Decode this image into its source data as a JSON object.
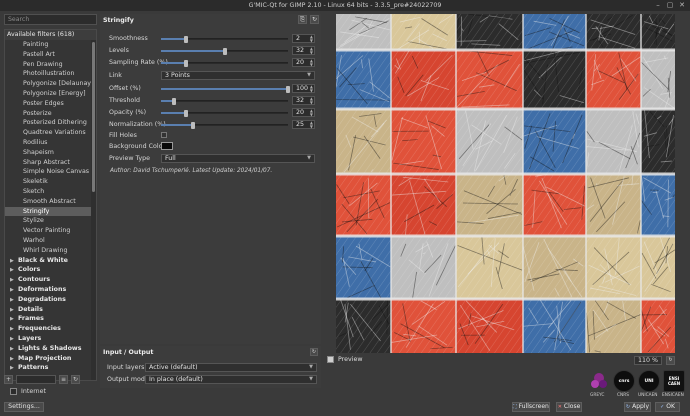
{
  "window": {
    "title": "G'MIC-Qt for GIMP 2.10 - Linux 64 bits - 3.3.5_pre#24022709",
    "controls": [
      "minimize-icon",
      "maximize-icon",
      "close-icon"
    ]
  },
  "search": {
    "placeholder": "Search"
  },
  "filter_list": {
    "header": "Available filters (618)",
    "items": [
      "Painting",
      "Pastell Art",
      "Pen Drawing",
      "Photoillustration",
      "Polygonize [Delaunay]",
      "Polygonize [Energy]",
      "Poster Edges",
      "Posterize",
      "Posterized Dithering",
      "Quadtree Variations",
      "Rodilius",
      "Shapeism",
      "Sharp Abstract",
      "Simple Noise Canvas",
      "Skeletik",
      "Sketch",
      "Smooth Abstract",
      "Stringify",
      "Stylize",
      "Vector Painting",
      "Warhol",
      "Whirl Drawing"
    ],
    "selected": "Stringify",
    "categories": [
      "Black & White",
      "Colors",
      "Contours",
      "Deformations",
      "Degradations",
      "Details",
      "Frames",
      "Frequencies",
      "Layers",
      "Lights & Shadows",
      "Map Projection",
      "Patterns"
    ]
  },
  "left_footer": {
    "internet_label": "Internet",
    "settings_label": "Settings..."
  },
  "filter": {
    "name": "Stringify",
    "params": {
      "smoothness": {
        "label": "Smoothness",
        "value": "2",
        "fraction": 0.2
      },
      "levels": {
        "label": "Levels",
        "value": "32",
        "fraction": 0.5
      },
      "sampling_rate": {
        "label": "Sampling Rate (%)",
        "value": "20",
        "fraction": 0.2
      },
      "link": {
        "label": "Link",
        "value": "3 Points"
      },
      "offset": {
        "label": "Offset (%)",
        "value": "100",
        "fraction": 1.0
      },
      "threshold": {
        "label": "Threshold",
        "value": "32",
        "fraction": 0.1
      },
      "opacity": {
        "label": "Opacity (%)",
        "value": "20",
        "fraction": 0.2
      },
      "normalization": {
        "label": "Normalization (%)",
        "value": "25",
        "fraction": 0.25
      },
      "fill_holes": {
        "label": "Fill Holes"
      },
      "background_color": {
        "label": "Background Color",
        "color": "#0a0a0a"
      },
      "preview_type": {
        "label": "Preview Type",
        "value": "Full"
      }
    },
    "author_line": "Author: David Tschumperlé.    Latest Update: 2024/01/07."
  },
  "io": {
    "title": "Input / Output",
    "input_layers_label": "Input layers",
    "input_layers_value": "Active (default)",
    "output_mode_label": "Output mode",
    "output_mode_value": "In place (default)"
  },
  "preview": {
    "label": "Preview",
    "zoom": "110 %"
  },
  "logos": [
    "GREYC",
    "CNRS",
    "UNICAEN",
    "ENSICAEN"
  ],
  "buttons": {
    "fullscreen": "Fullscreen",
    "close": "Close",
    "apply": "Apply",
    "ok": "OK"
  },
  "colors": {
    "accent": "#5a7fb0",
    "panel": "#3c3c3c",
    "background": "#3a3a3a"
  }
}
